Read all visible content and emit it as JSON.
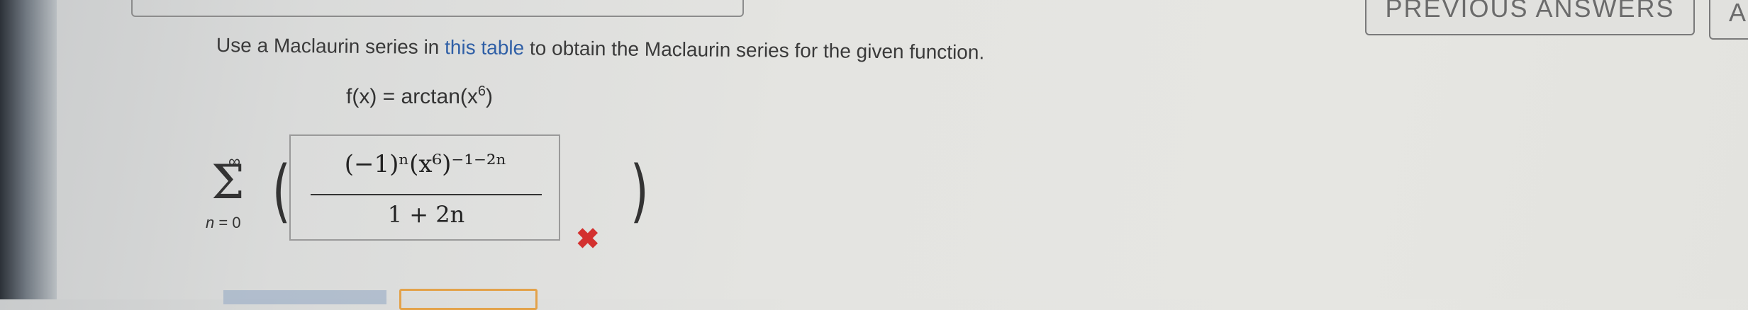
{
  "header": {
    "previous_answers_label": "PREVIOUS ANSWERS",
    "right_button_label": "A"
  },
  "question": {
    "instruction_pre": "Use a Maclaurin series in ",
    "instruction_link": "this table",
    "instruction_post": " to obtain the Maclaurin series for the given function.",
    "function_lhs": "f(x) = arctan(x",
    "function_exponent": "6",
    "function_rhs": ")"
  },
  "sum": {
    "upper": "∞",
    "symbol": "Σ",
    "lower_var": "n",
    "lower_eq": " = 0"
  },
  "answer": {
    "numerator": "(−1)ⁿ(x⁶)⁻¹⁻²ⁿ",
    "denominator": "1 + 2n",
    "status_icon": "incorrect-x-icon",
    "status_mark": "✖"
  },
  "colors": {
    "link": "#2f5fa6",
    "incorrect": "#d3312f",
    "bottom_button_border": "#e3a24a"
  }
}
